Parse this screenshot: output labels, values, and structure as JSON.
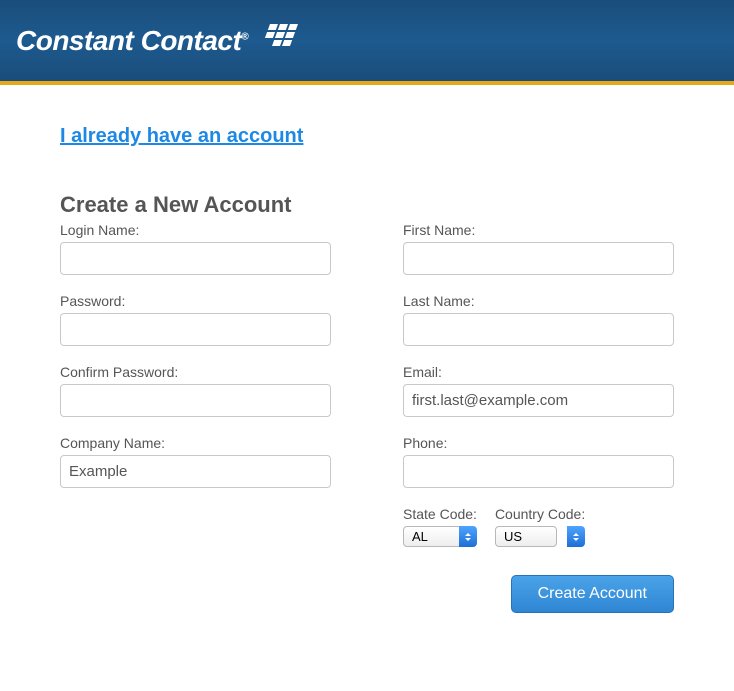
{
  "header": {
    "brand": "Constant Contact"
  },
  "links": {
    "existing_account": "I already have an account"
  },
  "form": {
    "title": "Create a New Account",
    "login_name": {
      "label": "Login Name:",
      "value": ""
    },
    "password": {
      "label": "Password:",
      "value": ""
    },
    "confirm_password": {
      "label": "Confirm Password:",
      "value": ""
    },
    "company_name": {
      "label": "Company Name:",
      "value": "Example"
    },
    "first_name": {
      "label": "First Name:",
      "value": ""
    },
    "last_name": {
      "label": "Last Name:",
      "value": ""
    },
    "email": {
      "label": "Email:",
      "value": "first.last@example.com"
    },
    "phone": {
      "label": "Phone:",
      "value": ""
    },
    "state_code": {
      "label": "State Code:",
      "value": "AL"
    },
    "country_code": {
      "label": "Country Code:",
      "value": "US"
    },
    "submit_label": "Create Account"
  }
}
